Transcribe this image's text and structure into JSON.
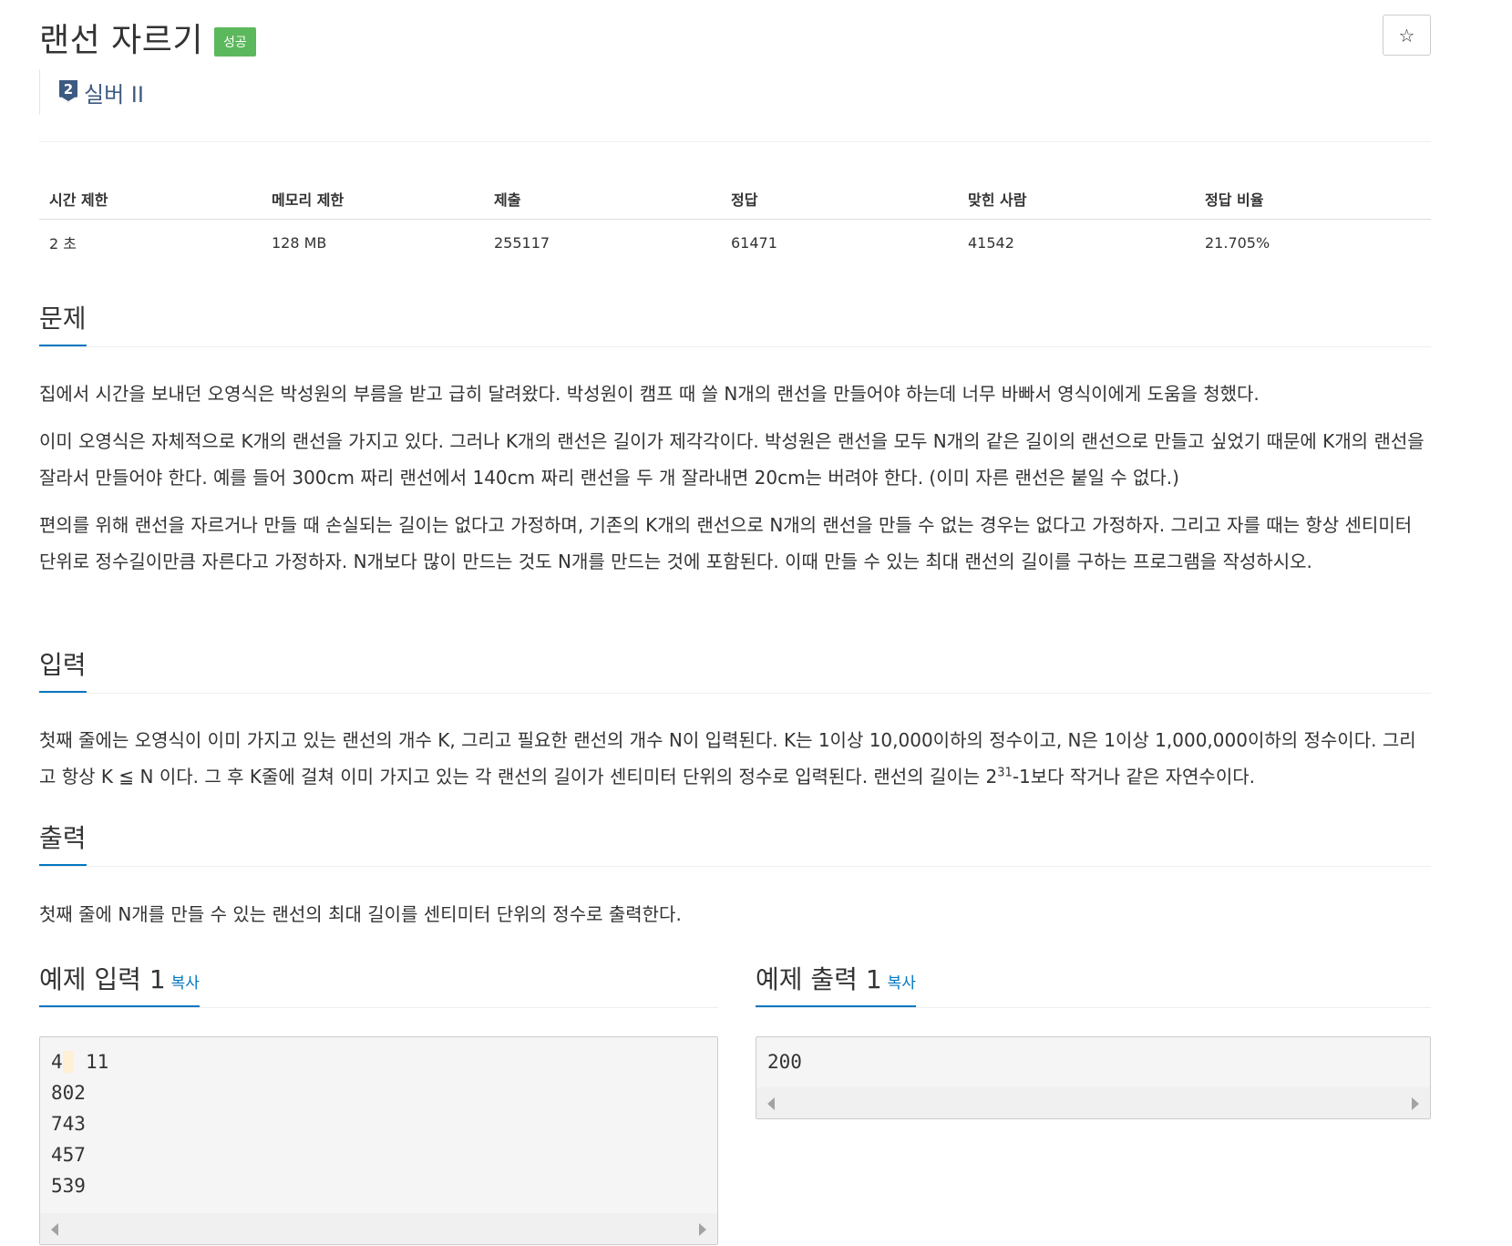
{
  "problem": {
    "title": "랜선 자르기",
    "result_badge": "성공",
    "star_icon": "☆",
    "tier_number": "2",
    "tier_label": "실버 II"
  },
  "info_table": {
    "headers": [
      "시간 제한",
      "메모리 제한",
      "제출",
      "정답",
      "맞힌 사람",
      "정답 비율"
    ],
    "values": [
      "2 초",
      "128 MB",
      "255117",
      "61471",
      "41542",
      "21.705%"
    ]
  },
  "sections": {
    "problem_title": "문제",
    "problem_p1": "집에서 시간을 보내던 오영식은 박성원의 부름을 받고 급히 달려왔다. 박성원이 캠프 때 쓸 N개의 랜선을 만들어야 하는데 너무 바빠서 영식이에게 도움을 청했다.",
    "problem_p2": "이미 오영식은 자체적으로 K개의 랜선을 가지고 있다. 그러나 K개의 랜선은 길이가 제각각이다. 박성원은 랜선을 모두 N개의 같은 길이의 랜선으로 만들고 싶었기 때문에 K개의 랜선을 잘라서 만들어야 한다. 예를 들어 300cm 짜리 랜선에서 140cm 짜리 랜선을 두 개 잘라내면 20cm는 버려야 한다. (이미 자른 랜선은 붙일 수 없다.)",
    "problem_p3": "편의를 위해 랜선을 자르거나 만들 때 손실되는 길이는 없다고 가정하며, 기존의 K개의 랜선으로 N개의 랜선을 만들 수 없는 경우는 없다고 가정하자. 그리고 자를 때는 항상 센티미터 단위로 정수길이만큼 자른다고 가정하자. N개보다 많이 만드는 것도 N개를 만드는 것에 포함된다. 이때 만들 수 있는 최대 랜선의 길이를 구하는 프로그램을 작성하시오.",
    "input_title": "입력",
    "input_p_before": "첫째 줄에는 오영식이 이미 가지고 있는 랜선의 개수 K, 그리고 필요한 랜선의 개수 N이 입력된다. K는 1이상 10,000이하의 정수이고, N은 1이상 1,000,000이하의 정수이다. 그리고 항상 K ≦ N 이다. 그 후 K줄에 걸쳐 이미 가지고 있는 각 랜선의 길이가 센티미터 단위의 정수로 입력된다. 랜선의 길이는 2",
    "input_p_sup": "31",
    "input_p_after": "-1보다 작거나 같은 자연수이다.",
    "output_title": "출력",
    "output_p": "첫째 줄에 N개를 만들 수 있는 랜선의 최대 길이를 센티미터 단위의 정수로 출력한다."
  },
  "samples": {
    "input_title": "예제 입력 1",
    "input_copy": "복사",
    "input_first_a": "4",
    "input_first_b": " 11",
    "input_rest": "802\n743\n457\n539",
    "output_title": "예제 출력 1",
    "output_copy": "복사",
    "output_text": "200"
  }
}
